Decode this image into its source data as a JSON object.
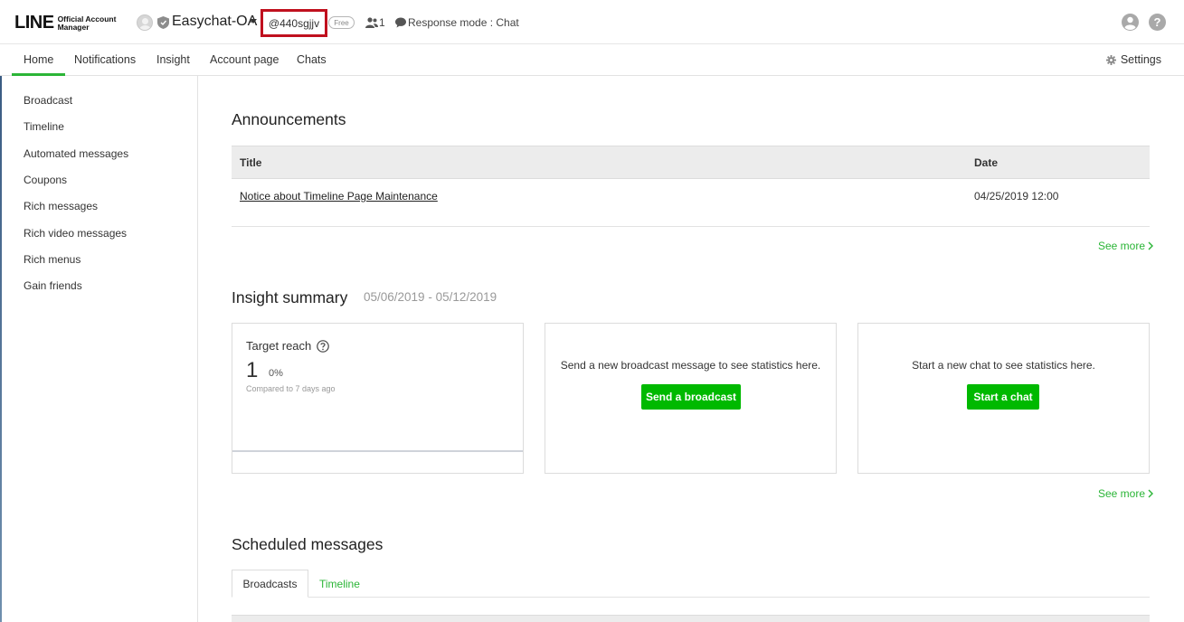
{
  "header": {
    "logo_main": "LINE",
    "logo_sub_line1": "Official Account",
    "logo_sub_line2": "Manager",
    "account_name": "Easychat-OA",
    "account_id": "@440sgjjv",
    "plan_badge": "Free",
    "friends_count": "1",
    "response_mode": "Response mode : Chat",
    "help_glyph": "?"
  },
  "nav": {
    "items": [
      "Home",
      "Notifications",
      "Insight",
      "Account page",
      "Chats"
    ],
    "active": "Home",
    "settings_label": "Settings"
  },
  "sidebar": {
    "items": [
      "Broadcast",
      "Timeline",
      "Automated messages",
      "Coupons",
      "Rich messages",
      "Rich video messages",
      "Rich menus",
      "Gain friends"
    ]
  },
  "announcements": {
    "title": "Announcements",
    "columns": [
      "Title",
      "Date"
    ],
    "rows": [
      {
        "title": "Notice about Timeline Page Maintenance",
        "date": "04/25/2019 12:00"
      }
    ],
    "see_more": "See more"
  },
  "insight": {
    "title": "Insight summary",
    "date_range": "05/06/2019 - 05/12/2019",
    "target_reach": {
      "label": "Target reach",
      "value": "1",
      "change": "0%",
      "compared": "Compared to 7 days ago"
    },
    "broadcast_card": {
      "text": "Send a new broadcast message to see statistics here.",
      "button": "Send a broadcast"
    },
    "chat_card": {
      "text": "Start a new chat to see statistics here.",
      "button": "Start a chat"
    },
    "see_more": "See more"
  },
  "scheduled": {
    "title": "Scheduled messages",
    "tabs": [
      "Broadcasts",
      "Timeline"
    ],
    "active_tab": "Broadcasts"
  },
  "colors": {
    "brand_green": "#00b900",
    "link_green": "#2bb537",
    "highlight_red": "#c0101e"
  }
}
